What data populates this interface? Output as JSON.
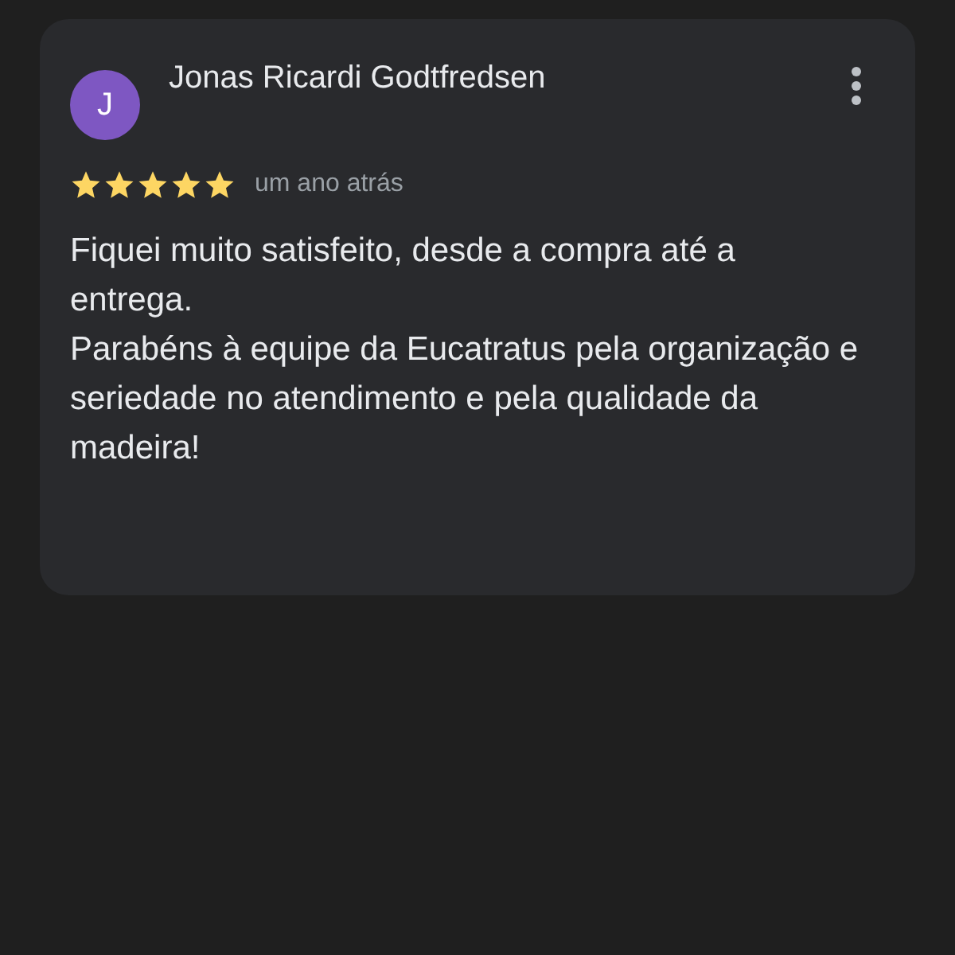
{
  "review": {
    "avatar_letter": "J",
    "author": "Jonas Ricardi Godtfredsen",
    "stars": 5,
    "time": "um ano atrás",
    "paragraphs": [
      "Fiquei muito satisfeito, desde a compra até a entrega.",
      "Parabéns à equipe da Eucatratus pela organização e seriedade no atendimento e pela qualidade da madeira!"
    ]
  }
}
